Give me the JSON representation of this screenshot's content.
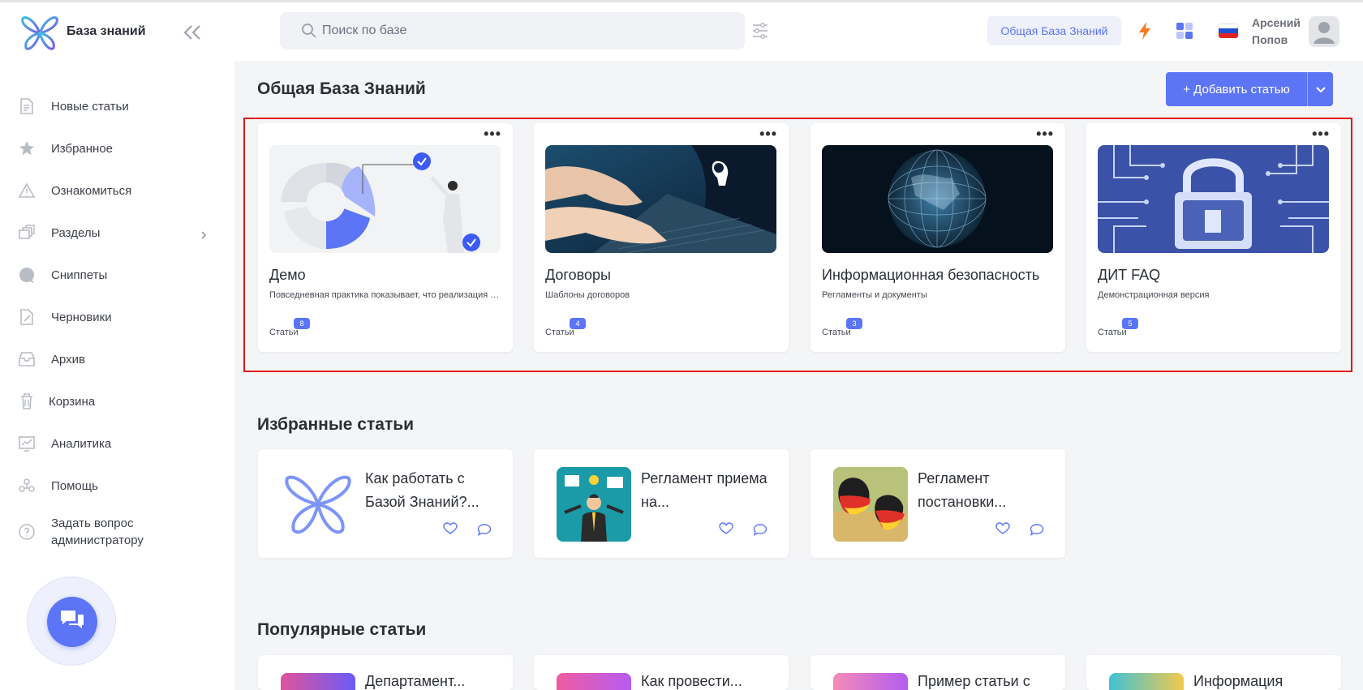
{
  "app": {
    "brand": "База знаний"
  },
  "sidebar": {
    "items": [
      {
        "label": "Новые статьи",
        "icon": "new-articles-icon"
      },
      {
        "label": "Избранное",
        "icon": "star-icon"
      },
      {
        "label": "Ознакомиться",
        "icon": "warning-icon"
      },
      {
        "label": "Разделы",
        "icon": "sections-icon",
        "has_submenu": true
      },
      {
        "label": "Сниппеты",
        "icon": "snippets-icon"
      },
      {
        "label": "Черновики",
        "icon": "drafts-icon"
      },
      {
        "label": "Архив",
        "icon": "archive-icon"
      },
      {
        "label": "Корзина",
        "icon": "trash-icon"
      },
      {
        "label": "Аналитика",
        "icon": "analytics-icon"
      },
      {
        "label": "Помощь",
        "icon": "help-icon"
      },
      {
        "label": "Задать вопрос администратору",
        "icon": "question-icon"
      }
    ]
  },
  "header": {
    "search_placeholder": "Поиск по базе",
    "kb_selector": "Общая База Знаний",
    "user": {
      "first_name": "Арсений",
      "last_name": "Попов"
    }
  },
  "main": {
    "title": "Общая База Знаний",
    "add_button": "+  Добавить статью",
    "knowledge_bases": [
      {
        "title": "Демо",
        "description": "Повседневная практика показывает, что реализация намеченных плановых заданий",
        "stat_label": "Статьи",
        "count": "8"
      },
      {
        "title": "Договоры",
        "description": "Шаблоны договоров",
        "stat_label": "Статьи",
        "count": "4"
      },
      {
        "title": "Информационная безопасность",
        "description": "Регламенты и документы",
        "stat_label": "Статьи",
        "count": "3"
      },
      {
        "title": "ДИТ FAQ",
        "description": "Демонстрационная версия",
        "stat_label": "Статьи",
        "count": "5"
      }
    ],
    "favorites_title": "Избранные статьи",
    "favorites": [
      {
        "title": "Как работать с Базой Знаний?..."
      },
      {
        "title": "Регламент приема на..."
      },
      {
        "title": "Регламент постановки..."
      }
    ],
    "popular_title": "Популярные статьи",
    "popular": [
      {
        "title": "Департамент..."
      },
      {
        "title": "Как провести..."
      },
      {
        "title": "Пример статьи с"
      },
      {
        "title": "Информация"
      }
    ]
  },
  "colors": {
    "accent": "#5b75f6",
    "highlight": "#e01818"
  }
}
